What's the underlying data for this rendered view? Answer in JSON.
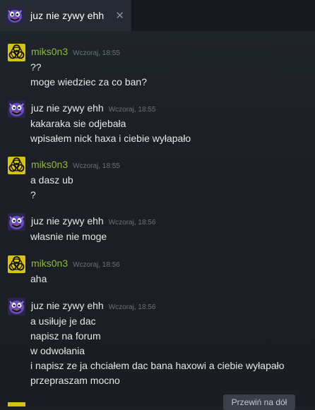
{
  "tab": {
    "title": "juz nie zywy ehh",
    "close": "✕"
  },
  "messages": [
    {
      "author": "miks0n3",
      "kind": "me",
      "time": "Wczoraj, 18:55",
      "lines": [
        "??",
        "moge wiedziec za co ban?"
      ]
    },
    {
      "author": "juz nie zywy ehh",
      "kind": "friend",
      "time": "Wczoraj, 18:55",
      "lines": [
        "kakaraka sie odjebała",
        "wpisałem nick haxa i ciebie wyłapało"
      ]
    },
    {
      "author": "miks0n3",
      "kind": "me",
      "time": "Wczoraj, 18:55",
      "lines": [
        "a dasz ub",
        "?"
      ]
    },
    {
      "author": "juz nie zywy ehh",
      "kind": "friend",
      "time": "Wczoraj, 18:56",
      "lines": [
        "własnie nie moge"
      ]
    },
    {
      "author": "miks0n3",
      "kind": "me",
      "time": "Wczoraj, 18:56",
      "lines": [
        "aha"
      ]
    },
    {
      "author": "juz nie zywy ehh",
      "kind": "friend",
      "time": "Wczoraj, 18:56",
      "lines": [
        "a usiłuje je dac",
        "napisz na forum",
        "w odwołania",
        "i napisz ze ja chciałem dac bana haxowi a ciebie wyłapało",
        "przepraszam mocno"
      ]
    }
  ],
  "scroll_button": "Przewiń na dół",
  "colors": {
    "me_name": "#8fb93b",
    "friend_name": "#e8e8e8",
    "biohazard_bg": "#d7c21a",
    "friend_avatar_bg": "#2b2450"
  },
  "icons": {
    "me_avatar": "biohazard-avatar-icon",
    "friend_avatar": "purple-monster-avatar-icon"
  }
}
